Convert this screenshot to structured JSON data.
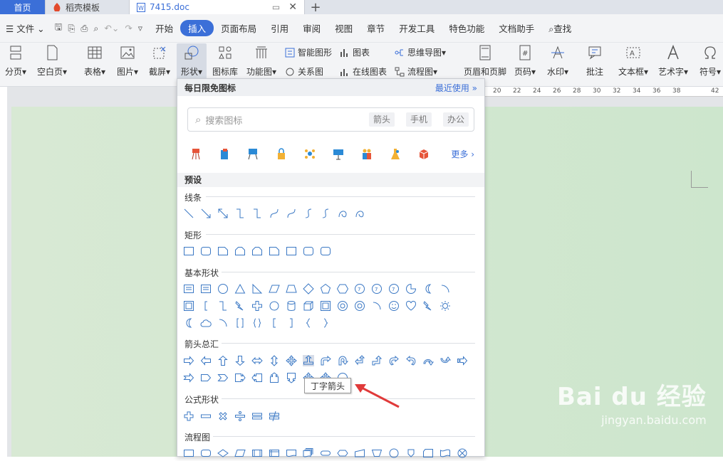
{
  "tabs": {
    "home": "首页",
    "daoke": "稻壳模板",
    "doc": "7415.doc"
  },
  "menu": {
    "file": "文件",
    "items": [
      "开始",
      "插入",
      "页面布局",
      "引用",
      "审阅",
      "视图",
      "章节",
      "开发工具",
      "特色功能",
      "文档助手"
    ],
    "active": "插入",
    "search": "查找"
  },
  "ribbon": {
    "fenye": "分页",
    "kongbai": "空白页",
    "biaoge": "表格",
    "tupian": "图片",
    "jieping": "截屏",
    "xingzhuang": "形状",
    "tubiaoku": "图标库",
    "gongneng": "功能图",
    "zhineng": "智能图形",
    "tubiao": "图表",
    "siwei": "思维导图",
    "guanxi": "关系图",
    "zaixian": "在线图表",
    "liucheng": "流程图",
    "yemei": "页眉和页脚",
    "yema": "页码",
    "shuiyin": "水印",
    "pizhu": "批注",
    "wenben": "文本框",
    "yishu": "艺术字",
    "fuhao": "符号"
  },
  "ruler": [
    "20",
    "22",
    "24",
    "26",
    "28",
    "30",
    "32",
    "34",
    "36",
    "38",
    "42"
  ],
  "panel": {
    "header": "每日限免图标",
    "recent": "最近使用",
    "search_placeholder": "搜索图标",
    "tags": [
      "箭头",
      "手机",
      "办公"
    ],
    "more": "更多",
    "preset": "预设",
    "sections": {
      "lines": "线条",
      "rect": "矩形",
      "basic": "基本形状",
      "arrows": "箭头总汇",
      "formula": "公式形状",
      "flow": "流程图"
    }
  },
  "tooltip": "丁字箭头",
  "watermark": {
    "brand": "Bai du 经验",
    "url": "jingyan.baidu.com"
  }
}
